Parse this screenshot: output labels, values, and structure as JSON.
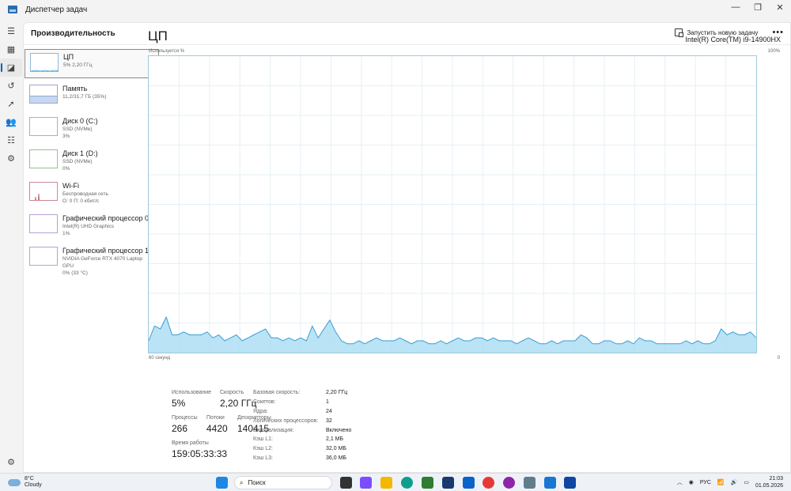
{
  "window": {
    "title": "Диспетчер задач",
    "minimize": "—",
    "maximize": "❐",
    "close": "✕"
  },
  "nav": {
    "icons": [
      "menu-icon",
      "processes-icon",
      "performance-icon",
      "app-history-icon",
      "startup-icon",
      "users-icon",
      "details-icon",
      "services-icon"
    ],
    "settings_icon": "gear-icon"
  },
  "header": {
    "title": "Производительность",
    "run_task": "Запустить новую задачу",
    "more": "•••"
  },
  "devices": [
    {
      "name": "ЦП",
      "sub1": "5% 2,20 ГГц",
      "sub2": ""
    },
    {
      "name": "Память",
      "sub1": "11,2/31,7 ГБ (35%)",
      "sub2": ""
    },
    {
      "name": "Диск 0 (C:)",
      "sub1": "SSD (NVMe)",
      "sub2": "3%"
    },
    {
      "name": "Диск 1 (D:)",
      "sub1": "SSD (NVMe)",
      "sub2": "0%"
    },
    {
      "name": "Wi-Fi",
      "sub1": "Беспроводная сеть",
      "sub2": "О: 0 П: 0 кбит/с"
    },
    {
      "name": "Графический процессор 0",
      "sub1": "Intel(R) UHD Graphics",
      "sub2": "1%"
    },
    {
      "name": "Графический процессор 1",
      "sub1": "NVIDIA GeForce RTX 4070 Laptop GPU",
      "sub2": "0% (33 °C)"
    }
  ],
  "cpu": {
    "title": "ЦП",
    "model": "Intel(R) Core(TM) i9-14900HX",
    "axis_top_left": "Используется %",
    "axis_top_right": "100%",
    "axis_bottom_left": "60 секунд",
    "axis_bottom_right": "0"
  },
  "chart_data": {
    "type": "area",
    "ylim": [
      0,
      100
    ],
    "x_range_seconds": [
      60,
      0
    ],
    "grid": true,
    "values": [
      4,
      9,
      8,
      12,
      6,
      6,
      7,
      6,
      6,
      6,
      7,
      5,
      6,
      4,
      5,
      6,
      4,
      5,
      6,
      7,
      8,
      5,
      5,
      4,
      5,
      4,
      5,
      4,
      9,
      5,
      8,
      11,
      7,
      4,
      3,
      3,
      4,
      3,
      4,
      5,
      4,
      4,
      4,
      5,
      4,
      3,
      4,
      4,
      3,
      3,
      4,
      3,
      4,
      5,
      4,
      4,
      5,
      5,
      4,
      5,
      4,
      4,
      4,
      3,
      4,
      5,
      4,
      3,
      3,
      4,
      3,
      4,
      4,
      4,
      6,
      5,
      3,
      3,
      4,
      4,
      3,
      3,
      4,
      3,
      5,
      4,
      4,
      3,
      3,
      3,
      3,
      3,
      4,
      3,
      4,
      3,
      3,
      4,
      8,
      6,
      7,
      6,
      6,
      7,
      5
    ],
    "color": "#a9dcf2",
    "line_color": "#3b9ed6"
  },
  "stats": {
    "usage_label": "Использование",
    "usage": "5%",
    "speed_label": "Скорость",
    "speed": "2,20 ГГц",
    "processes_label": "Процессы",
    "processes": "266",
    "threads_label": "Потоки",
    "threads": "4420",
    "handles_label": "Дескрипторы",
    "handles": "140415",
    "uptime_label": "Время работы",
    "uptime": "159:05:33:33"
  },
  "specs": [
    {
      "key": "Базовая скорость:",
      "val": "2,20 ГГц"
    },
    {
      "key": "Сокетов:",
      "val": "1"
    },
    {
      "key": "Ядра:",
      "val": "24"
    },
    {
      "key": "Логических процессоров:",
      "val": "32"
    },
    {
      "key": "Виртуализация:",
      "val": "Включено"
    },
    {
      "key": "Кэш L1:",
      "val": "2,1 МБ"
    },
    {
      "key": "Кэш L2:",
      "val": "32,0 МБ"
    },
    {
      "key": "Кэш L3:",
      "val": "36,0 МБ"
    }
  ],
  "taskbar": {
    "temp": "8°C",
    "weather": "Cloudy",
    "search": "Поиск",
    "lang": "РУС",
    "time": "21:03",
    "date": "01.05.2026"
  }
}
